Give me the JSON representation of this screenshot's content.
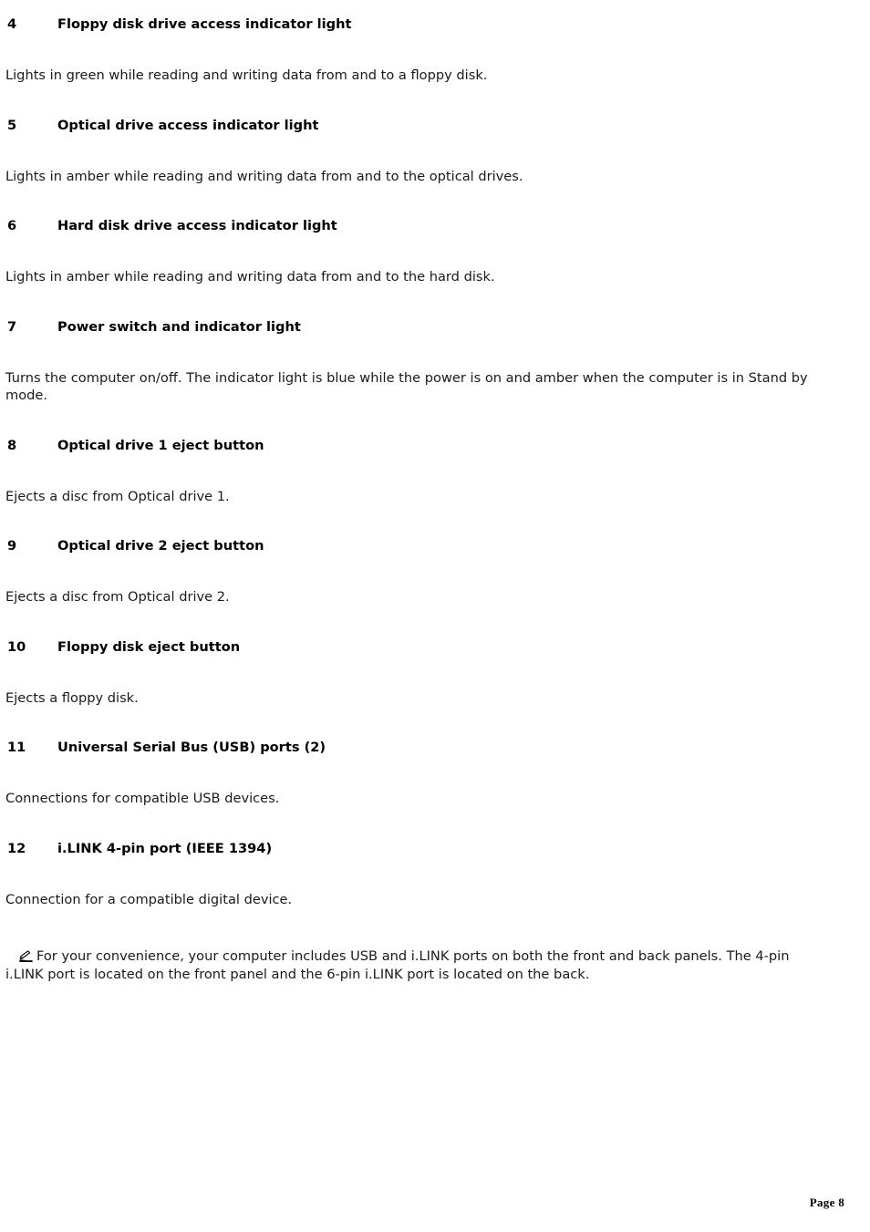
{
  "document": {
    "entries": [
      {
        "number": "4",
        "label": "Floppy disk drive access indicator light",
        "body": "Lights in green while reading and writing data from and to a floppy disk."
      },
      {
        "number": "5",
        "label": "Optical drive access indicator light",
        "body": "Lights in amber while reading and writing data from and to the optical drives."
      },
      {
        "number": "6",
        "label": "Hard disk drive access indicator light",
        "body": "Lights in amber while reading and writing data from and to the hard disk."
      },
      {
        "number": "7",
        "label": "Power switch and indicator light",
        "body": "Turns the computer on/off. The indicator light is blue while the power is on and amber when the computer is in Stand by mode."
      },
      {
        "number": "8",
        "label": "Optical drive 1 eject button",
        "body": "Ejects a disc from Optical drive 1."
      },
      {
        "number": "9",
        "label": "Optical drive 2 eject button",
        "body": "Ejects a disc from Optical drive 2."
      },
      {
        "number": "10",
        "label": "Floppy disk eject button",
        "body": "Ejects a floppy disk."
      },
      {
        "number": "11",
        "label": "Universal Serial Bus (USB) ports (2)",
        "body": "Connections for compatible USB devices."
      },
      {
        "number": "12",
        "label": "i.LINK 4-pin port (IEEE 1394)",
        "body": "Connection for a compatible digital device."
      }
    ],
    "note": {
      "icon": "note-hand-pencil-icon",
      "text": "For your convenience, your computer includes USB and i.LINK ports on both the front and back panels. The 4-pin i.LINK port is located on the front panel and the 6-pin i.LINK port is located on the back."
    },
    "footer": {
      "page_label": "Page 8"
    }
  }
}
